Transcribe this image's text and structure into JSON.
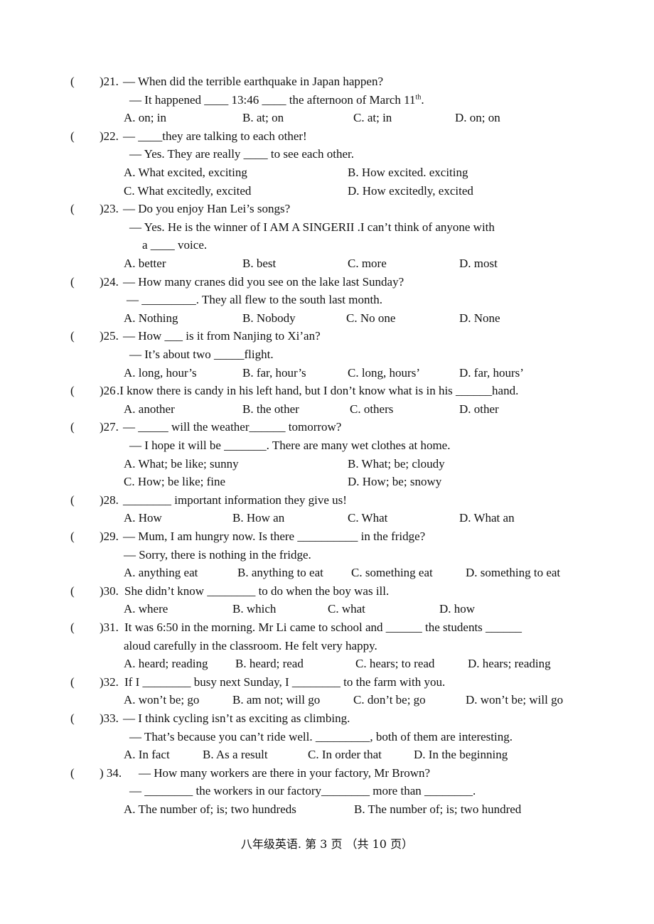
{
  "questions": [
    {
      "number": "21.",
      "stem": "— When did the terrible earthquake in Japan happen?",
      "lines": [
        "— It happened ____ 13:46 ____ the afternoon of March 11"
      ],
      "line_sup": "th",
      "line_tail": ".",
      "options": [
        "A. on; in",
        "B. at; on",
        "C. at; in",
        "D. on; on"
      ]
    },
    {
      "number": "22.",
      "stem": "— ____they are talking to each other!",
      "lines": [
        "— Yes. They are really ____ to see each other."
      ],
      "options": [
        "A. What excited, exciting",
        "B. How excited. exciting",
        "C. What excitedly, excited",
        "D. How excitedly, excited"
      ]
    },
    {
      "number": "23.",
      "stem": "— Do you enjoy Han Lei’s songs?",
      "lines": [
        "— Yes. He is the winner of I AM A SINGERII .I can’t think of anyone with",
        "a ____ voice."
      ],
      "options": [
        "A. better",
        "B. best",
        "C. more",
        "D. most"
      ]
    },
    {
      "number": "24.",
      "stem": "— How many cranes did you see on the lake last Sunday?",
      "lines": [
        "— _________. They all flew to the south last month."
      ],
      "options": [
        "A. Nothing",
        "B. Nobody",
        "C. No one",
        "D. None"
      ]
    },
    {
      "number": "25.",
      "stem": "— How ___ is it from Nanjing to Xi’an?",
      "lines": [
        "— It’s about two _____flight."
      ],
      "options": [
        "A. long, hour’s",
        "B. far, hour’s",
        "C. long, hours’",
        "D. far, hours’"
      ]
    },
    {
      "number": "26",
      "stem": ".I know there is candy in his left hand, but I don’t know what is in his ______hand.",
      "lines": [],
      "options": [
        "A. another",
        "B. the other",
        "C. others",
        "D. other"
      ]
    },
    {
      "number": "27.",
      "stem": "— _____ will the weather______ tomorrow?",
      "lines": [
        "— I hope it will be _______. There are many wet clothes at home."
      ],
      "options": [
        "A. What; be like; sunny",
        "B. What; be; cloudy",
        "C. How; be like; fine",
        "D. How; be; snowy"
      ]
    },
    {
      "number": "28.",
      "stem": "________ important information they give us!",
      "lines": [],
      "options": [
        "A. How",
        "B. How an",
        "C. What",
        "D. What an"
      ]
    },
    {
      "number": "29.",
      "stem": "— Mum, I am hungry now. Is there __________ in the fridge?",
      "lines": [
        "— Sorry, there is nothing in the fridge."
      ],
      "options": [
        "A. anything eat",
        "B. anything to eat",
        "C. something eat",
        "D. something to eat"
      ]
    },
    {
      "number": "30.",
      "stem": "She didn’t know ________ to do when the boy was ill.",
      "lines": [],
      "options": [
        "A. where",
        "B. which",
        "C. what",
        "D. how"
      ]
    },
    {
      "number": "31.",
      "stem": "It was 6:50 in the morning. Mr Li came to school and ______ the students ______",
      "lines": [
        "aloud carefully in the classroom. He felt very happy."
      ],
      "options": [
        "A. heard; reading",
        "B. heard; read",
        "C. hears; to read",
        "D. hears; reading"
      ]
    },
    {
      "number": "32.",
      "stem": "If I ________ busy next Sunday, I ________ to the farm with you.",
      "lines": [],
      "options": [
        "A. won’t be; go",
        "B. am not; will go",
        "C. don’t be; go",
        "D. won’t be; will go"
      ]
    },
    {
      "number": "33.",
      "stem": "— I think cycling isn’t as exciting as climbing.",
      "lines": [
        "— That’s because you can’t ride well. _________, both of them are interesting."
      ],
      "options": [
        "A. In fact",
        "B. As a result",
        "C. In order that",
        "D. In the beginning"
      ]
    },
    {
      "number": " 34.",
      "stem": "— How many workers are there in your factory, Mr Brown?",
      "lines": [
        "— ________ the workers in our factory________ more than ________."
      ],
      "options": [
        "A. The number of; is; two hundreds",
        "B. The number of; is; two hundred"
      ]
    }
  ],
  "paren": "(",
  "footer": "八年级英语. 第 3 页 （共 10 页）"
}
